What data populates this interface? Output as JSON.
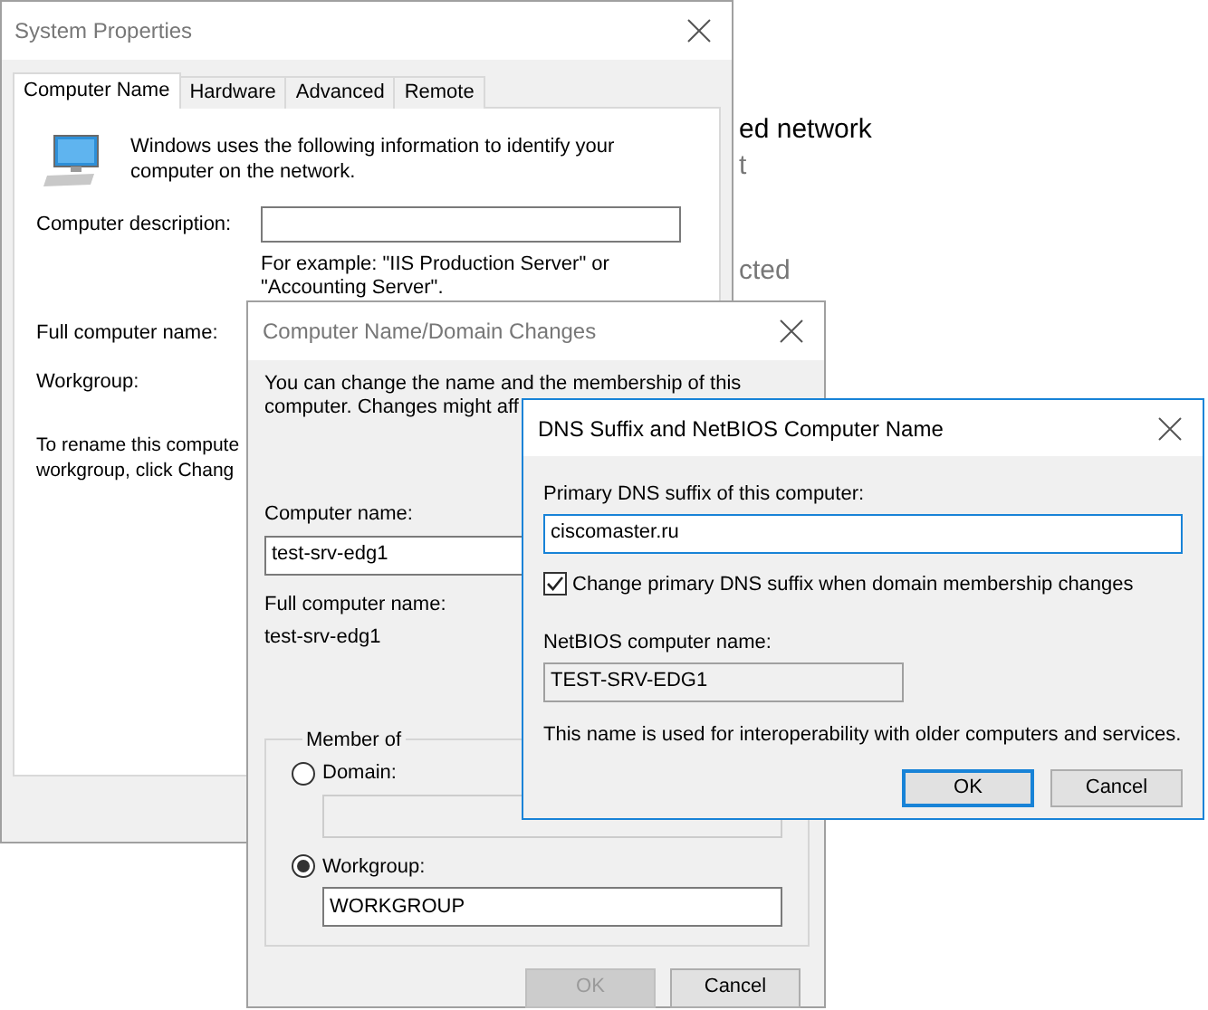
{
  "background_page": {
    "lines": [
      {
        "text": "ed network",
        "kind": "heading"
      },
      {
        "text": "t",
        "kind": "muted"
      },
      {
        "text": "cted",
        "kind": "muted"
      }
    ]
  },
  "system_properties": {
    "title": "System Properties",
    "tabs": [
      {
        "label": "Computer Name",
        "selected": true
      },
      {
        "label": "Hardware",
        "selected": false
      },
      {
        "label": "Advanced",
        "selected": false
      },
      {
        "label": "Remote",
        "selected": false
      }
    ],
    "intro": "Windows uses the following information to identify your computer on the network.",
    "description_label": "Computer description:",
    "description_hint": "For example: \"IIS Production Server\" or \"Accounting Server\".",
    "full_name_label": "Full computer name:",
    "workgroup_label": "Workgroup:",
    "rename_lines": [
      "To rename this compute",
      "workgroup, click Chang"
    ]
  },
  "name_changes": {
    "title": "Computer Name/Domain Changes",
    "intro_lines": [
      "You can change the name and the membership of this",
      "computer. Changes might aff"
    ],
    "computer_name_label": "Computer name:",
    "computer_name": "test-srv-edg1",
    "full_name_label": "Full computer name:",
    "full_name": "test-srv-edg1",
    "member_of": "Member of",
    "options": [
      {
        "label": "Domain:",
        "selected": false
      },
      {
        "label": "Workgroup:",
        "selected": true,
        "value": "WORKGROUP"
      }
    ],
    "buttons": [
      {
        "label": "OK",
        "disabled": true
      },
      {
        "label": "Cancel",
        "disabled": false
      }
    ]
  },
  "dns_dialog": {
    "title": "DNS Suffix and NetBIOS Computer Name",
    "suffix_label": "Primary DNS suffix of this computer:",
    "suffix": "ciscomaster.ru",
    "change_suffix": {
      "label": "Change primary DNS suffix when domain membership changes",
      "checked": true
    },
    "netbios_label": "NetBIOS computer name:",
    "netbios_name": "TEST-SRV-EDG1",
    "note": "This name is used for interoperability with older computers and services.",
    "buttons": [
      {
        "label": "OK",
        "default": true
      },
      {
        "label": "Cancel",
        "default": false
      }
    ]
  }
}
